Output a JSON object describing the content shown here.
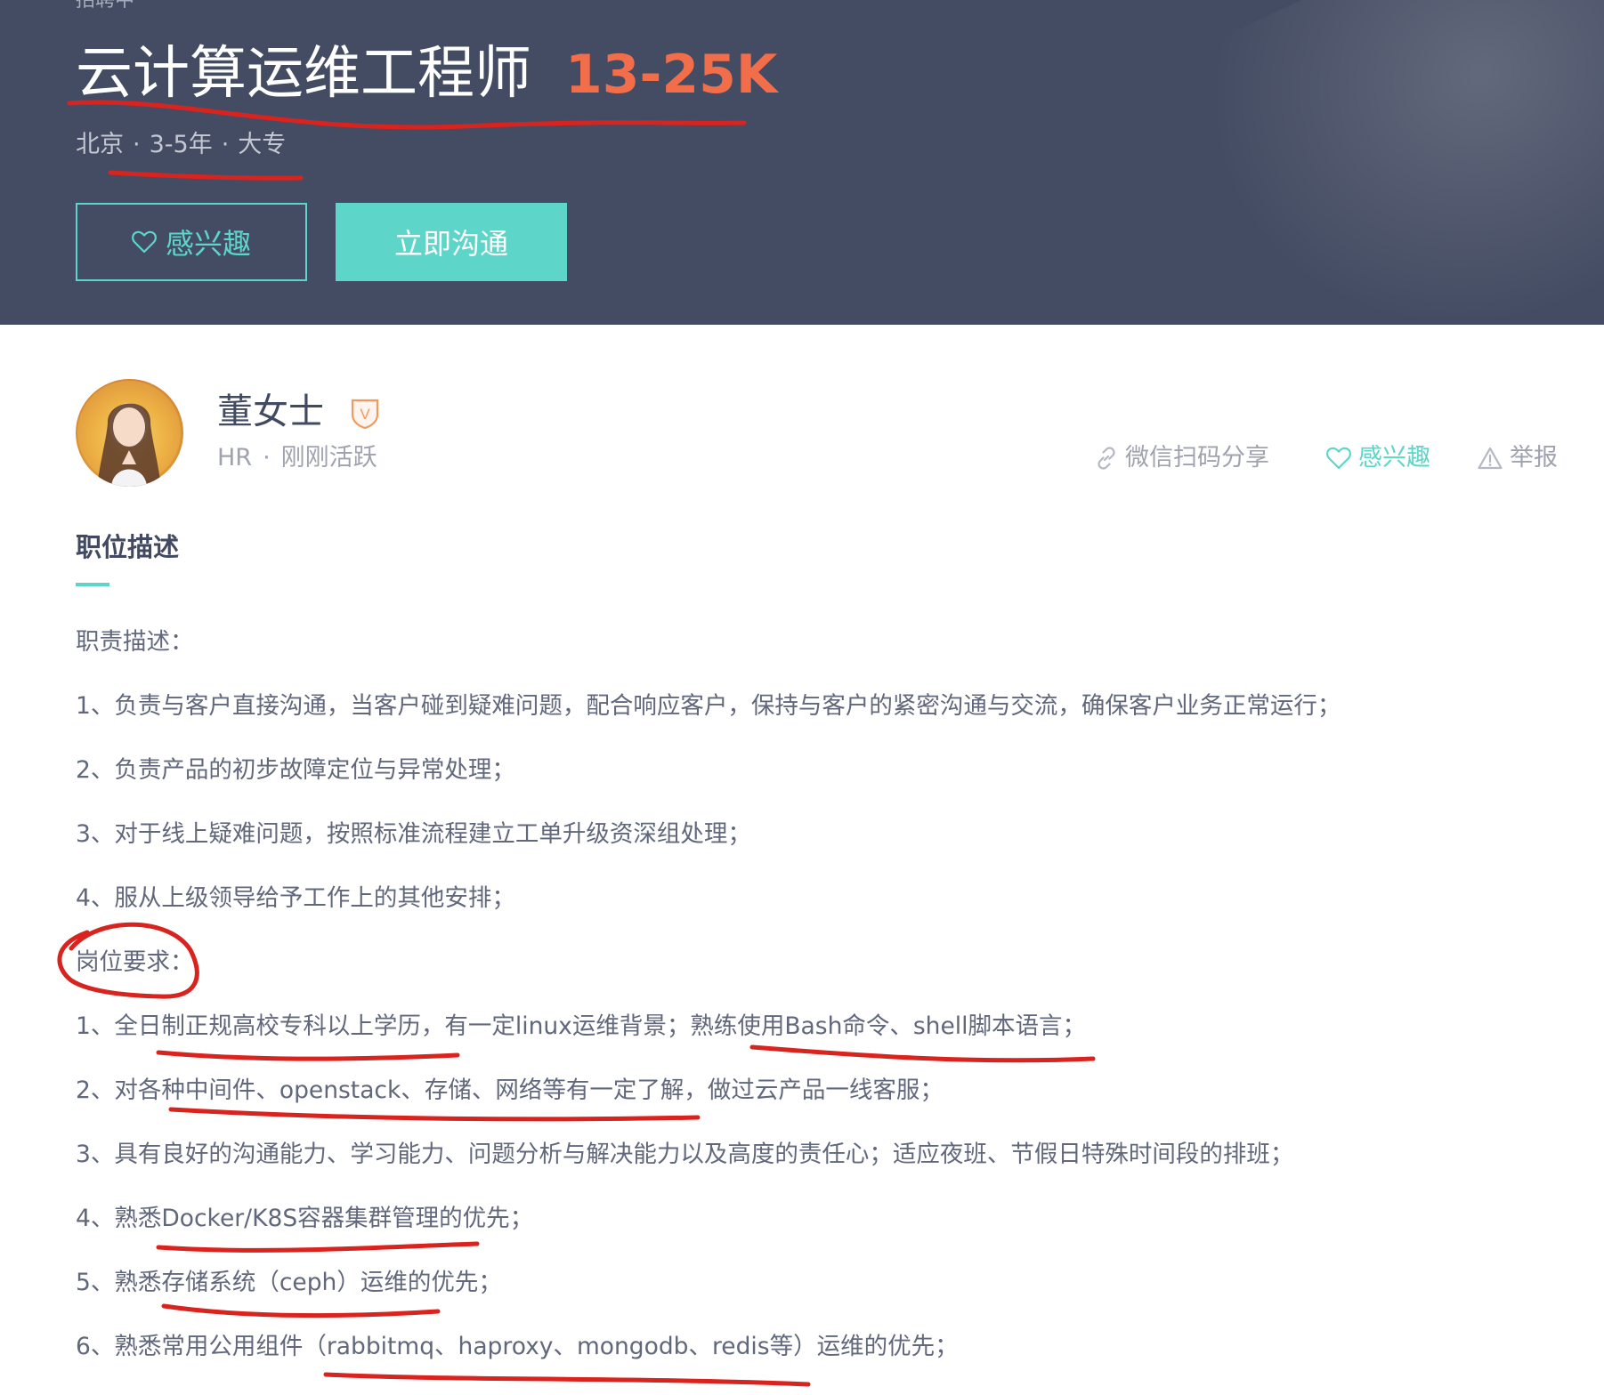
{
  "header": {
    "status": "招聘中",
    "title": "云计算运维工程师",
    "salary": "13-25K",
    "meta": {
      "city": "北京",
      "experience": "3-5年",
      "education": "大专",
      "separator": "·"
    },
    "interest_button": "感兴趣",
    "chat_button": "立即沟通",
    "colors": {
      "banner": "#444c63",
      "accent": "#5dd5c8",
      "salary": "#f26d49"
    }
  },
  "recruiter": {
    "name": "董女士",
    "badge_letter": "V",
    "role": "HR",
    "separator": "·",
    "activity": "刚刚活跃",
    "share_label": "微信扫码分享",
    "interest_label": "感兴趣",
    "report_label": "举报"
  },
  "description": {
    "section_title": "职位描述",
    "responsibilities_heading": "职责描述：",
    "responsibilities": [
      "1、负责与客户直接沟通，当客户碰到疑难问题，配合响应客户，保持与客户的紧密沟通与交流，确保客户业务正常运行；",
      "2、负责产品的初步故障定位与异常处理；",
      "3、对于线上疑难问题，按照标准流程建立工单升级资深组处理；",
      "4、服从上级领导给予工作上的其他安排；"
    ],
    "requirements_heading": "岗位要求：",
    "requirements": [
      "1、全日制正规高校专科以上学历，有一定linux运维背景；熟练使用Bash命令、shell脚本语言；",
      "2、对各种中间件、openstack、存储、网络等有一定了解，做过云产品一线客服；",
      "3、具有良好的沟通能力、学习能力、问题分析与解决能力以及高度的责任心；适应夜班、节假日特殊时间段的排班；",
      "4、熟悉Docker/K8S容器集群管理的优先；",
      "5、熟悉存储系统（ceph）运维的优先；",
      "6、熟悉常用公用组件（rabbitmq、haproxy、mongodb、redis等）运维的优先；"
    ]
  },
  "annotations": {
    "ink_color": "#d8231f"
  }
}
